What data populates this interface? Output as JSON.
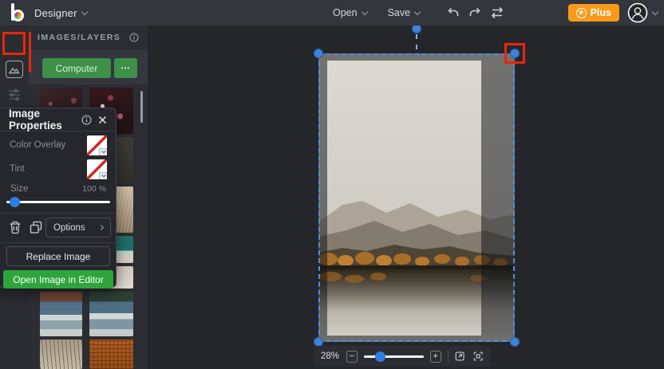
{
  "header": {
    "app_name": "Designer",
    "open_label": "Open",
    "save_label": "Save",
    "plus_label": "Plus",
    "star_glyph": "★"
  },
  "sidebar": {
    "title": "IMAGES/LAYERS",
    "computer_button": "Computer",
    "more_button": "•••"
  },
  "properties_panel": {
    "title": "Image Properties",
    "color_overlay_label": "Color Overlay",
    "tint_label": "Tint",
    "size_label": "Size",
    "size_value": "100 %",
    "options_label": "Options",
    "replace_button": "Replace Image",
    "open_editor_button": "Open Image in Editor"
  },
  "zoom_bar": {
    "level": "28%",
    "minus": "−",
    "plus": "+"
  },
  "colors": {
    "top_bar": "#34363d",
    "canvas_bg": "#25262a",
    "accent_green": "#3e8f48",
    "editor_green": "#2da53c",
    "accent_orange": "#f89b1b",
    "handle_blue": "#3b82d8",
    "slider_blue": "#2e7ee4",
    "annotation_red": "#e8270d"
  }
}
